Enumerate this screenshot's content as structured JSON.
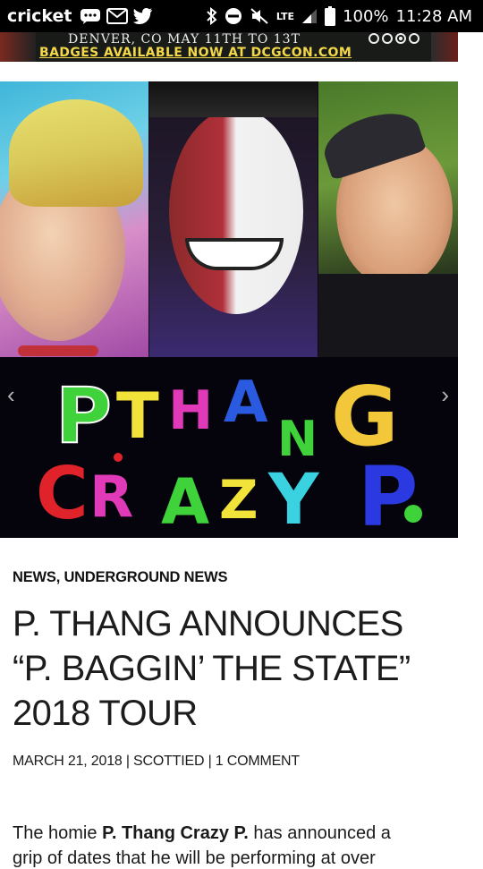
{
  "status_bar": {
    "carrier": "cricket",
    "network": "LTE",
    "battery": "100%",
    "time": "11:28 AM",
    "icons": [
      "chat-bubble-icon",
      "gmail-icon",
      "twitter-icon",
      "bluetooth-icon",
      "do-not-disturb-icon",
      "mute-icon",
      "lte-icon",
      "signal-icon",
      "battery-icon"
    ]
  },
  "ad": {
    "line1": "DENVER, CO   MAY 11TH TO 13T",
    "line2": "BADGES AVAILABLE NOW AT DCGCON.COM"
  },
  "hero": {
    "logo_line1": "P. THANG",
    "logo_line2": "CRAZY P."
  },
  "article": {
    "category": "NEWS, UNDERGROUND NEWS",
    "title_line1": "P. THANG ANNOUNCES",
    "title_line2": "“P. BAGGIN’ THE STATE”",
    "title_line3": "2018 TOUR",
    "meta": "MARCH 21, 2018 | SCOTTIED | 1 COMMENT",
    "body_prefix": "The homie ",
    "body_name": "P. Thang Crazy P.",
    "body_suffix": " has announced a",
    "body_line2": "grip of dates that he will be performing at over"
  },
  "colors": {
    "status_bg": "#000000",
    "ad_bg": "#191b18",
    "ad_accent": "#f3d94a",
    "text": "#1c1c1c"
  }
}
